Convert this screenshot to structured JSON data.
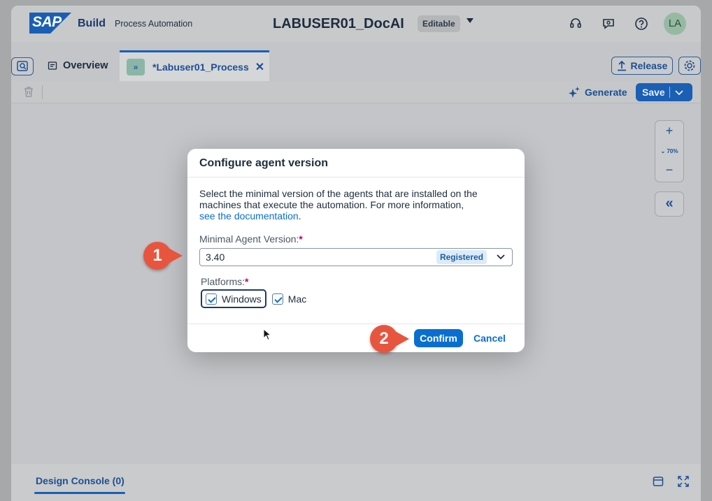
{
  "shell": {
    "logo": "SAP",
    "product": "Build",
    "area": "Process Automation",
    "project": "LABUSER01_DocAI",
    "status_badge": "Editable",
    "avatar": "LA"
  },
  "tabs": {
    "overview": "Overview",
    "process": "*Labuser01_Process",
    "process_icon": "»"
  },
  "actions": {
    "release": "Release",
    "generate": "Generate",
    "save": "Save"
  },
  "zoom": {
    "level": "70%"
  },
  "console": {
    "tab": "Design Console (0)"
  },
  "dialog": {
    "title": "Configure agent version",
    "description": "Select the minimal version of the agents that are installed on the machines that execute the automation. For more information,",
    "link": "see the documentation",
    "link_suffix": ".",
    "version_label": "Minimal Agent Version:",
    "version_value": "3.40",
    "version_badge": "Registered",
    "platforms_label": "Platforms:",
    "required_mark": "*",
    "platforms": [
      {
        "label": "Windows",
        "checked": true
      },
      {
        "label": "Mac",
        "checked": true
      }
    ],
    "confirm": "Confirm",
    "cancel": "Cancel"
  },
  "markers": [
    "1",
    "2"
  ],
  "colors": {
    "accent": "#0a6ed1",
    "brand": "#1a5fb4",
    "marker": "#e8553f",
    "required": "#b8055e"
  }
}
